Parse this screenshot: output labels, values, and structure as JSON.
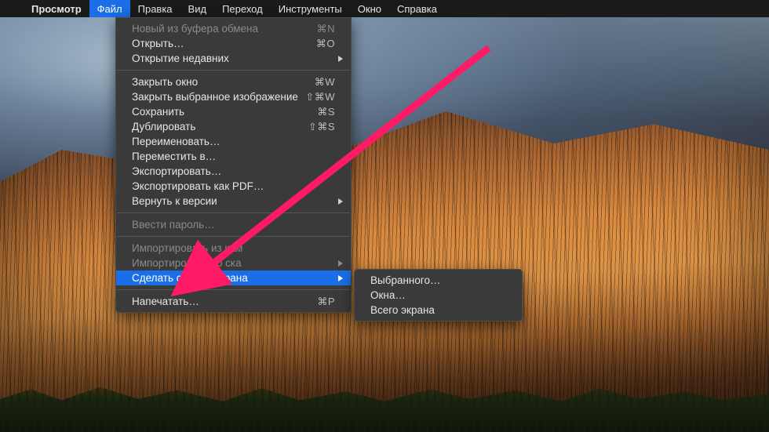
{
  "menubar": {
    "app_name": "Просмотр",
    "items": [
      "Файл",
      "Правка",
      "Вид",
      "Переход",
      "Инструменты",
      "Окно",
      "Справка"
    ],
    "active_index": 0
  },
  "dropdown": {
    "groups": [
      [
        {
          "label": "Новый из буфера обмена",
          "shortcut": "⌘N",
          "disabled": true
        },
        {
          "label": "Открыть…",
          "shortcut": "⌘O"
        },
        {
          "label": "Открытие недавних",
          "submenu": true
        }
      ],
      [
        {
          "label": "Закрыть окно",
          "shortcut": "⌘W"
        },
        {
          "label": "Закрыть выбранное изображение",
          "shortcut": "⇧⌘W"
        },
        {
          "label": "Сохранить",
          "shortcut": "⌘S"
        },
        {
          "label": "Дублировать",
          "shortcut": "⇧⌘S"
        },
        {
          "label": "Переименовать…"
        },
        {
          "label": "Переместить в…"
        },
        {
          "label": "Экспортировать…"
        },
        {
          "label": "Экспортировать как PDF…"
        },
        {
          "label": "Вернуть к версии",
          "submenu": true
        }
      ],
      [
        {
          "label": "Ввести пароль…",
          "disabled": true
        }
      ],
      [
        {
          "label": "Импортировать из кам",
          "disabled": true
        },
        {
          "label": "Импортировать со ска",
          "disabled": true,
          "submenu": true
        },
        {
          "label": "Сделать снимок экрана",
          "submenu": true,
          "highlight": true
        }
      ],
      [
        {
          "label": "Напечатать…",
          "shortcut": "⌘P"
        }
      ]
    ]
  },
  "submenu": {
    "items": [
      {
        "label": "Выбранного…"
      },
      {
        "label": "Окна…"
      },
      {
        "label": "Всего экрана"
      }
    ]
  },
  "annotation": {
    "arrow_color": "#ff1a66"
  }
}
